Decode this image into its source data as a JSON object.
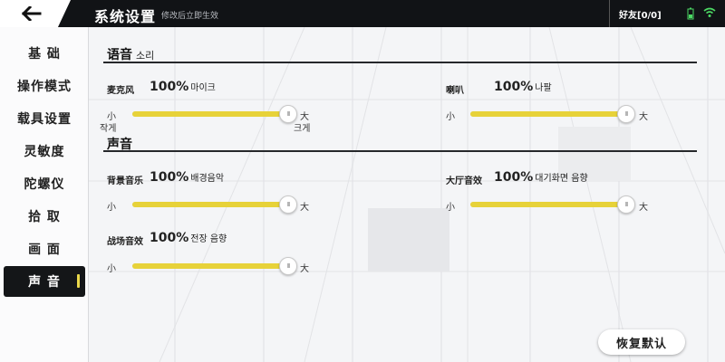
{
  "header": {
    "title": "系统设置",
    "subtitle": "修改后立即生效",
    "friends": "好友[0/0]",
    "back_icon": "back-arrow-icon",
    "battery_icon": "battery-icon",
    "wifi_icon": "wifi-icon",
    "accent": "#e7d239"
  },
  "sidebar": {
    "items": [
      {
        "label": "基 础"
      },
      {
        "label": "操作模式"
      },
      {
        "label": "载具设置"
      },
      {
        "label": "灵敏度"
      },
      {
        "label": "陀螺仪"
      },
      {
        "label": "拾 取"
      },
      {
        "label": "画 面"
      },
      {
        "label": "声 音"
      }
    ],
    "active_index": 7
  },
  "voice_section": {
    "title": "语音",
    "subtitle": "소리",
    "mic": {
      "label": "麦克风",
      "value": "100%",
      "native": "마이크",
      "min": "小",
      "max": "大",
      "min_native": "작게",
      "max_native": "크게",
      "level": 1.0
    },
    "speaker": {
      "label": "喇叭",
      "value": "100%",
      "native": "나팔",
      "min": "小",
      "max": "大",
      "level": 1.0
    }
  },
  "sound_section": {
    "title": "声音",
    "bgm": {
      "label": "背景音乐",
      "value": "100%",
      "native": "배경음악",
      "min": "小",
      "max": "大",
      "level": 1.0
    },
    "lobby": {
      "label": "大厅音效",
      "value": "100%",
      "native": "대기화면 음향",
      "min": "小",
      "max": "大",
      "level": 1.0
    },
    "battle": {
      "label": "战场音效",
      "value": "100%",
      "native": "전장 음향",
      "min": "小",
      "max": "大",
      "level": 1.0
    }
  },
  "reset_label": "恢复默认"
}
